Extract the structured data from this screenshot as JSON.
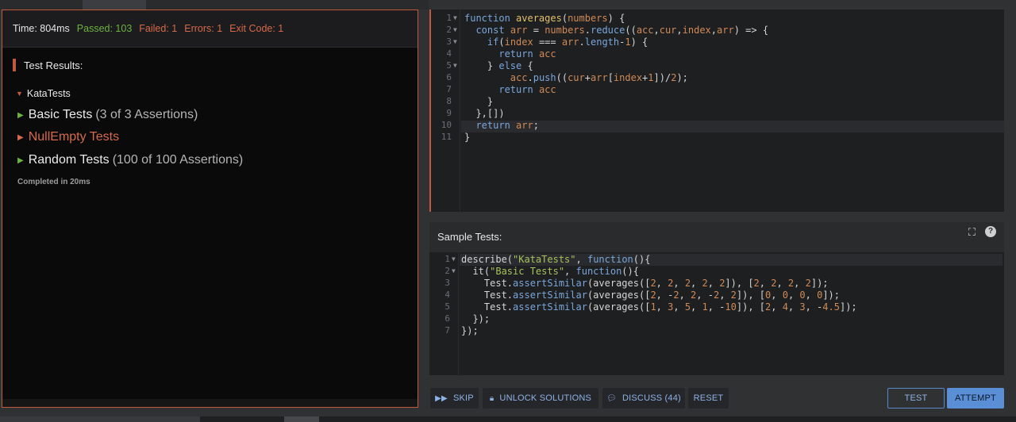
{
  "stats": {
    "time": "Time: 804ms",
    "passed": "Passed: 103",
    "failed": "Failed: 1",
    "errors": "Errors: 1",
    "exit_code": "Exit Code: 1"
  },
  "results": {
    "title": "Test Results:",
    "root": "KataTests",
    "tests": [
      {
        "name": "Basic Tests",
        "assertions": "(3 of 3 Assertions)",
        "status": "pass"
      },
      {
        "name": "NullEmpty Tests",
        "assertions": "",
        "status": "fail"
      },
      {
        "name": "Random Tests",
        "assertions": "(100 of 100 Assertions)",
        "status": "pass"
      }
    ],
    "completed": "Completed in 20ms"
  },
  "solution_editor": {
    "line_numbers": [
      "1",
      "2",
      "3",
      "4",
      "5",
      "6",
      "7",
      "8",
      "9",
      "10",
      "11"
    ],
    "highlighted_line": 10
  },
  "samples": {
    "title": "Sample Tests:",
    "line_numbers": [
      "1",
      "2",
      "3",
      "4",
      "5",
      "6",
      "7"
    ]
  },
  "buttons": {
    "skip": "SKIP",
    "unlock": "UNLOCK SOLUTIONS",
    "discuss": "DISCUSS (44)",
    "reset": "RESET",
    "test": "TEST",
    "attempt": "ATTEMPT"
  },
  "icons": {
    "skip": "fast-forward-icon",
    "unlock": "lock-icon",
    "discuss": "chat-bubbles-icon",
    "expand": "expand-icon",
    "help": "help-icon"
  },
  "colors": {
    "accent": "#c15a3c",
    "pass": "#6cb33f",
    "fail": "#d66a4a",
    "primary_button": "#5a8fd6"
  }
}
